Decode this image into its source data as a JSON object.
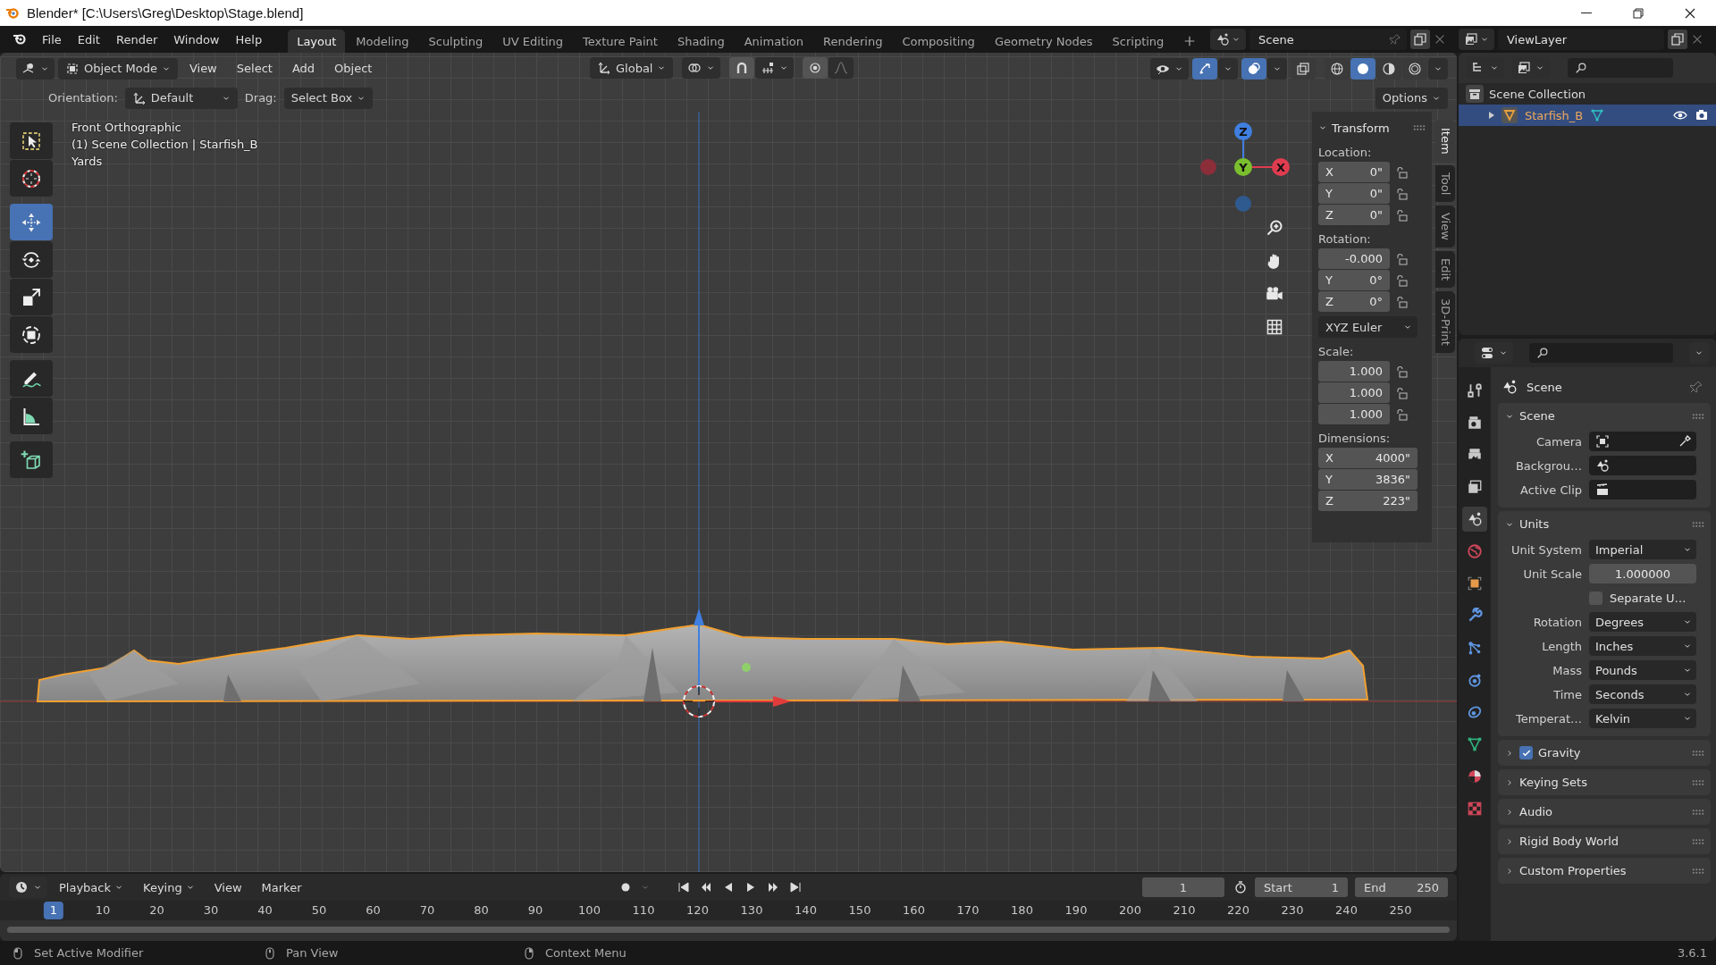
{
  "window": {
    "title": "Blender* [C:\\Users\\Greg\\Desktop\\Stage.blend]"
  },
  "menu": [
    "File",
    "Edit",
    "Render",
    "Window",
    "Help"
  ],
  "workspaces": [
    {
      "label": "Layout",
      "selected": true
    },
    {
      "label": "Modeling",
      "selected": false
    },
    {
      "label": "Sculpting",
      "selected": false
    },
    {
      "label": "UV Editing",
      "selected": false
    },
    {
      "label": "Texture Paint",
      "selected": false
    },
    {
      "label": "Shading",
      "selected": false
    },
    {
      "label": "Animation",
      "selected": false
    },
    {
      "label": "Rendering",
      "selected": false
    },
    {
      "label": "Compositing",
      "selected": false
    },
    {
      "label": "Geometry Nodes",
      "selected": false
    },
    {
      "label": "Scripting",
      "selected": false
    }
  ],
  "scene": {
    "name": "Scene"
  },
  "view_layer": {
    "name": "ViewLayer"
  },
  "viewport_header": {
    "mode": "Object Mode",
    "menus": [
      "View",
      "Select",
      "Add",
      "Object"
    ],
    "orientation": "Global",
    "gizmos_on": true,
    "overlays_on": true,
    "xray": false,
    "shading": [
      {
        "kind": "wireframe",
        "selected": false
      },
      {
        "kind": "solid",
        "selected": true
      },
      {
        "kind": "material",
        "selected": false
      },
      {
        "kind": "rendered",
        "selected": false
      }
    ]
  },
  "tool_settings": {
    "orientation_label": "Orientation:",
    "orientation": "Default",
    "drag_label": "Drag:",
    "drag": "Select Box",
    "options": "Options"
  },
  "viewport": {
    "overlay_lines": [
      "Front Orthographic",
      "(1) Scene Collection | Starfish_B",
      "Yards"
    ],
    "gizmo_axes": [
      "Z",
      "Y",
      "X"
    ],
    "toolbar": [
      {
        "tools": [
          {
            "kind": "select-box",
            "selected": false
          },
          {
            "kind": "cursor",
            "selected": false
          }
        ]
      },
      {
        "tools": [
          {
            "kind": "move",
            "selected": true
          },
          {
            "kind": "rotate",
            "selected": false
          },
          {
            "kind": "scale",
            "selected": false
          },
          {
            "kind": "transform",
            "selected": false
          }
        ]
      },
      {
        "tools": [
          {
            "kind": "annotate",
            "selected": false
          },
          {
            "kind": "measure",
            "selected": false
          }
        ]
      },
      {
        "tools": [
          {
            "kind": "add-cube",
            "selected": false
          }
        ]
      }
    ]
  },
  "sidebar": {
    "tabs": [
      {
        "label": "Item",
        "selected": true
      },
      {
        "label": "Tool",
        "selected": false
      },
      {
        "label": "View",
        "selected": false
      },
      {
        "label": "Edit",
        "selected": false
      },
      {
        "label": "3D-Print",
        "selected": false
      }
    ],
    "panel_title": "Transform",
    "groups": [
      {
        "label": "Location:",
        "locks": true,
        "fields": [
          {
            "axis": "X",
            "value": "0\""
          },
          {
            "axis": "Y",
            "value": "0\""
          },
          {
            "axis": "Z",
            "value": "0\""
          }
        ]
      },
      {
        "label": "Rotation:",
        "locks": true,
        "fields": [
          {
            "value": "-0.000"
          },
          {
            "axis": "Y",
            "value": "0°"
          },
          {
            "axis": "Z",
            "value": "0°"
          }
        ],
        "mode": "XYZ Euler"
      },
      {
        "label": "Scale:",
        "locks": true,
        "fields": [
          {
            "value": "1.000"
          },
          {
            "value": "1.000"
          },
          {
            "value": "1.000"
          }
        ]
      },
      {
        "label": "Dimensions:",
        "locks": false,
        "fields": [
          {
            "axis": "X",
            "value": "4000\""
          },
          {
            "axis": "Y",
            "value": "3836\""
          },
          {
            "axis": "Z",
            "value": "223\""
          }
        ]
      }
    ]
  },
  "outliner": {
    "root": "Scene Collection",
    "items": [
      {
        "name": "Starfish_B",
        "selected": true
      }
    ]
  },
  "properties": {
    "context": "Scene",
    "tabs": [
      {
        "kind": "tool",
        "selected": false
      },
      {
        "kind": "render",
        "selected": false
      },
      {
        "kind": "output",
        "selected": false
      },
      {
        "kind": "view_layer",
        "selected": false
      },
      {
        "kind": "scene",
        "selected": true
      },
      {
        "kind": "world",
        "selected": false
      },
      {
        "kind": "object",
        "selected": false
      },
      {
        "kind": "modifier",
        "selected": false
      },
      {
        "kind": "particles",
        "selected": false
      },
      {
        "kind": "physics",
        "selected": false
      },
      {
        "kind": "constraints",
        "selected": false
      },
      {
        "kind": "data",
        "selected": false
      },
      {
        "kind": "material",
        "selected": false
      },
      {
        "kind": "texture",
        "selected": false
      }
    ],
    "panels": [
      {
        "title": "Scene",
        "expanded": true,
        "rows": [
          {
            "kind": "camera",
            "label": "Camera"
          },
          {
            "kind": "scene",
            "label": "Backgrou…"
          },
          {
            "kind": "clip",
            "label": "Active Clip"
          }
        ]
      },
      {
        "title": "Units",
        "expanded": true,
        "rows": [
          {
            "kind": "dropdown",
            "label": "Unit System",
            "value": "Imperial"
          },
          {
            "kind": "number",
            "label": "Unit Scale",
            "value": "1.000000"
          },
          {
            "kind": "checkbox",
            "label": "Separate U…",
            "checked": false
          },
          {
            "kind": "dropdown",
            "label": "Rotation",
            "value": "Degrees"
          },
          {
            "kind": "dropdown",
            "label": "Length",
            "value": "Inches"
          },
          {
            "kind": "dropdown",
            "label": "Mass",
            "value": "Pounds"
          },
          {
            "kind": "dropdown",
            "label": "Time",
            "value": "Seconds"
          },
          {
            "kind": "dropdown",
            "label": "Temperat…",
            "value": "Kelvin"
          }
        ]
      },
      {
        "title": "Gravity",
        "expanded": false,
        "checked": true
      },
      {
        "title": "Keying Sets",
        "expanded": false
      },
      {
        "title": "Audio",
        "expanded": false
      },
      {
        "title": "Rigid Body World",
        "expanded": false
      },
      {
        "title": "Custom Properties",
        "expanded": false
      }
    ]
  },
  "timeline": {
    "menus": [
      {
        "label": "Playback",
        "dropdown": true
      },
      {
        "label": "Keying",
        "dropdown": true
      },
      {
        "label": "View",
        "dropdown": false
      },
      {
        "label": "Marker",
        "dropdown": false
      }
    ],
    "current_frame": "1",
    "start_label": "Start",
    "start": "1",
    "end_label": "End",
    "end": "250",
    "ruler": [
      {
        "label": "1",
        "selected": true
      },
      {
        "label": "10",
        "selected": false
      },
      {
        "label": "20",
        "selected": false
      },
      {
        "label": "30",
        "selected": false
      },
      {
        "label": "40",
        "selected": false
      },
      {
        "label": "50",
        "selected": false
      },
      {
        "label": "60",
        "selected": false
      },
      {
        "label": "70",
        "selected": false
      },
      {
        "label": "80",
        "selected": false
      },
      {
        "label": "90",
        "selected": false
      },
      {
        "label": "100",
        "selected": false
      },
      {
        "label": "110",
        "selected": false
      },
      {
        "label": "120",
        "selected": false
      },
      {
        "label": "130",
        "selected": false
      },
      {
        "label": "140",
        "selected": false
      },
      {
        "label": "150",
        "selected": false
      },
      {
        "label": "160",
        "selected": false
      },
      {
        "label": "170",
        "selected": false
      },
      {
        "label": "180",
        "selected": false
      },
      {
        "label": "190",
        "selected": false
      },
      {
        "label": "200",
        "selected": false
      },
      {
        "label": "210",
        "selected": false
      },
      {
        "label": "220",
        "selected": false
      },
      {
        "label": "230",
        "selected": false
      },
      {
        "label": "240",
        "selected": false
      },
      {
        "label": "250",
        "selected": false
      }
    ]
  },
  "status_bar": {
    "hints": [
      {
        "kind": "left-click",
        "text": "Set Active Modifier"
      },
      {
        "kind": "middle-click",
        "text": "Pan View"
      },
      {
        "kind": "right-click",
        "text": "Context Menu"
      }
    ],
    "version": "3.6.1"
  }
}
